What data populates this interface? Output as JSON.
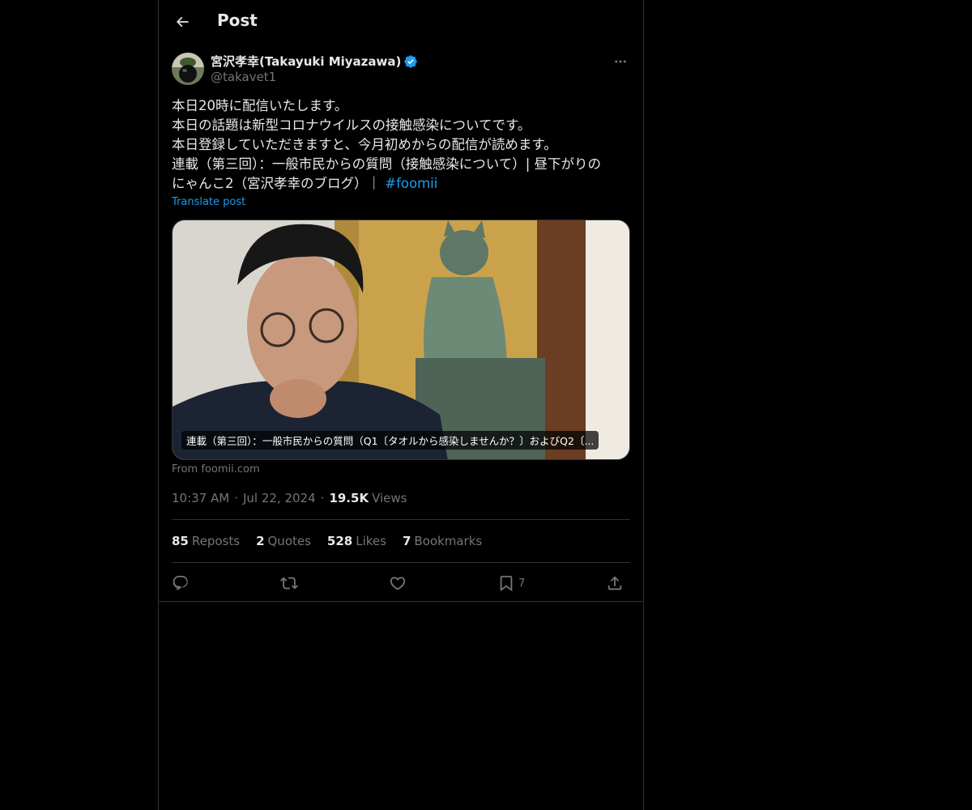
{
  "header": {
    "title": "Post",
    "back_icon": "arrow-left-icon"
  },
  "author": {
    "display_name": "宮沢孝幸(Takayuki Miyazawa)",
    "handle": "@takavet1",
    "verified_icon": "verified-badge-icon",
    "verified_color": "#1d9bf0"
  },
  "tweet": {
    "lines": [
      "本日20時に配信いたします。",
      "本日の話題は新型コロナウイルスの接触感染についてです。",
      "本日登録していただきますと、今月初めからの配信が読めます。",
      "連載（第三回）：一般市民からの質問（接触感染について）| 昼下がりの",
      "にゃんこ2（宮沢孝幸のブログ）｜"
    ],
    "hashtag": "#foomii",
    "translate_label": "Translate post"
  },
  "card": {
    "caption": "連載（第三回）：一般市民からの質問（Q1〔タオルから感染しませんか？〕およびQ2〔...",
    "source": "From foomii.com"
  },
  "meta": {
    "time": "10:37 AM",
    "date": "Jul 22, 2024",
    "views_count": "19.5K",
    "views_label": "Views",
    "separator": "·"
  },
  "stats": [
    {
      "count": "85",
      "label": "Reposts"
    },
    {
      "count": "2",
      "label": "Quotes"
    },
    {
      "count": "528",
      "label": "Likes"
    },
    {
      "count": "7",
      "label": "Bookmarks"
    }
  ],
  "actions": {
    "reply_icon": "reply-icon",
    "repost_icon": "repost-icon",
    "like_icon": "heart-icon",
    "bookmark_icon": "bookmark-icon",
    "bookmark_count": "7",
    "share_icon": "share-icon"
  },
  "colors": {
    "accent": "#1d9bf0",
    "background": "#000000",
    "text": "#e7e9ea",
    "muted": "#71767b",
    "border": "#2f3336"
  }
}
